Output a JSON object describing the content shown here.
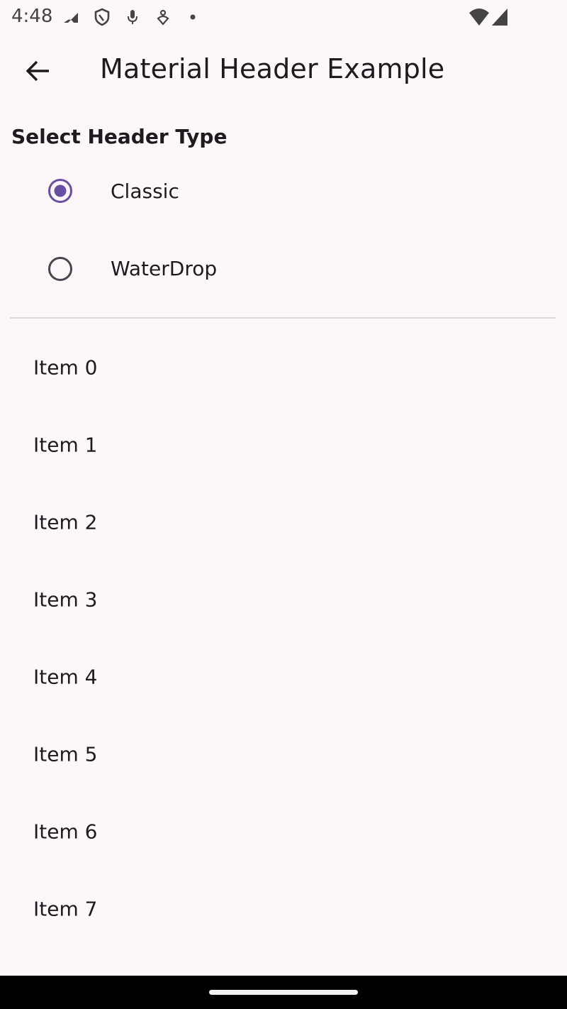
{
  "status_bar": {
    "time": "4:48",
    "left_icons": [
      "data-saver-icon",
      "shield-icon",
      "mic-icon",
      "pin-icon",
      "dot-icon"
    ],
    "right_icons": [
      "wifi-icon",
      "signal-icon"
    ]
  },
  "app_bar": {
    "title": "Material Header Example",
    "back_icon": "arrow-back-icon"
  },
  "header_type": {
    "title": "Select Header Type",
    "options": [
      {
        "label": "Classic",
        "selected": true
      },
      {
        "label": "WaterDrop",
        "selected": false
      }
    ]
  },
  "list": {
    "items": [
      "Item 0",
      "Item 1",
      "Item 2",
      "Item 3",
      "Item 4",
      "Item 5",
      "Item 6",
      "Item 7"
    ]
  },
  "colors": {
    "background": "#fdf7fa",
    "accent": "#6750a4",
    "text": "#1d1b20",
    "radio_unselected": "#49454f"
  }
}
